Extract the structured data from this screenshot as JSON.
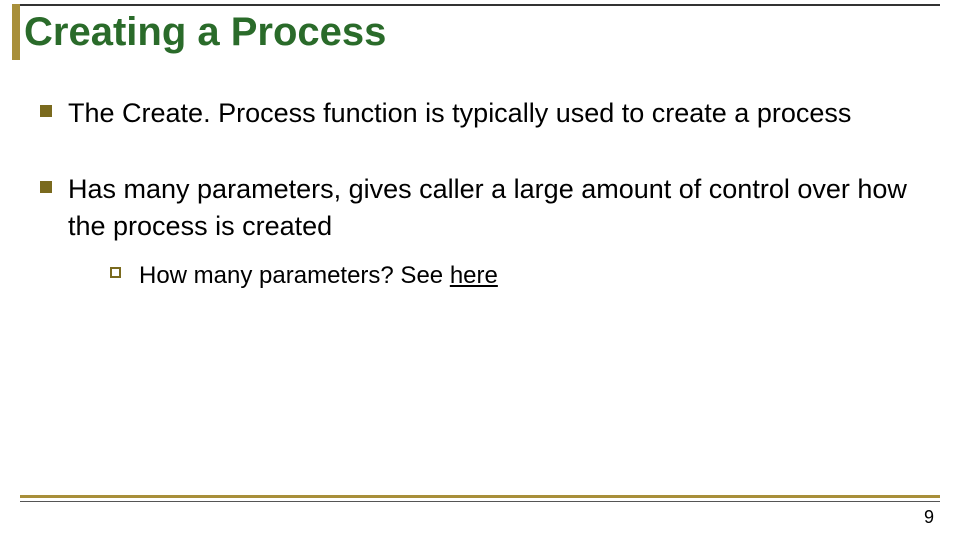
{
  "title": "Creating a Process",
  "bullets": {
    "b1": "The Create. Process function is typically used to create a process",
    "b2": "Has many parameters, gives caller a large amount of control over how the process is created",
    "sub_prefix": "How many parameters?  See ",
    "sub_link": "here"
  },
  "page": "9"
}
